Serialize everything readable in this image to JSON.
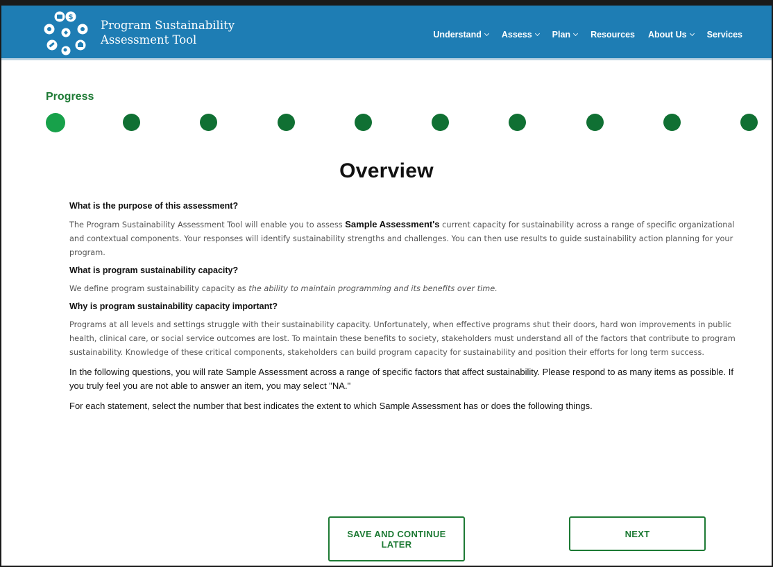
{
  "header": {
    "logo_line1": "Program Sustainability",
    "logo_line2": "Assessment Tool",
    "nav": [
      {
        "label": "Understand",
        "dropdown": true
      },
      {
        "label": "Assess",
        "dropdown": true
      },
      {
        "label": "Plan",
        "dropdown": true
      },
      {
        "label": "Resources",
        "dropdown": false
      },
      {
        "label": "About Us",
        "dropdown": true
      },
      {
        "label": "Services",
        "dropdown": false
      }
    ]
  },
  "progress": {
    "label": "Progress",
    "total_steps": 10,
    "current_step": 1
  },
  "main": {
    "title": "Overview",
    "q1": "What is the purpose of this assessment?",
    "p1_a": "The Program Sustainability Assessment Tool will enable you to assess ",
    "p1_bold": "Sample Assessment's",
    "p1_b": " current capacity for sustainability across a range of specific organizational and contextual components. Your responses will identify sustainability strengths and challenges. You can then use results to guide sustainability action planning for your program.",
    "q2": "What is program sustainability capacity?",
    "p2_a": "We define program sustainability capacity as ",
    "p2_italic": "the ability to maintain programming and its benefits over time.",
    "q3": "Why is program sustainability capacity important?",
    "p3": "Programs at all levels and settings struggle with their sustainability capacity. Unfortunately, when effective programs shut their doors, hard won improvements in public health, clinical care, or social service outcomes are lost. To maintain these benefits to society, stakeholders must understand all of the factors that contribute to program sustainability. Knowledge of these critical components, stakeholders can build program capacity for sustainability and position their efforts for long term success.",
    "instr1": "In the following questions, you will rate Sample Assessment across a range of specific factors that affect sustainability. Please respond to as many items as possible. If you truly feel you are not able to answer an item, you may select \"NA.\"",
    "instr2": "For each statement, select the number that best indicates the extent to which Sample Assessment has or does the following things."
  },
  "buttons": {
    "save_label": "SAVE AND CONTINUE LATER",
    "next_label": "NEXT"
  },
  "colors": {
    "header_bg": "#1e7db4",
    "brand_green": "#1d7a34",
    "dot": "#107033",
    "dot_current": "#17a14a"
  }
}
